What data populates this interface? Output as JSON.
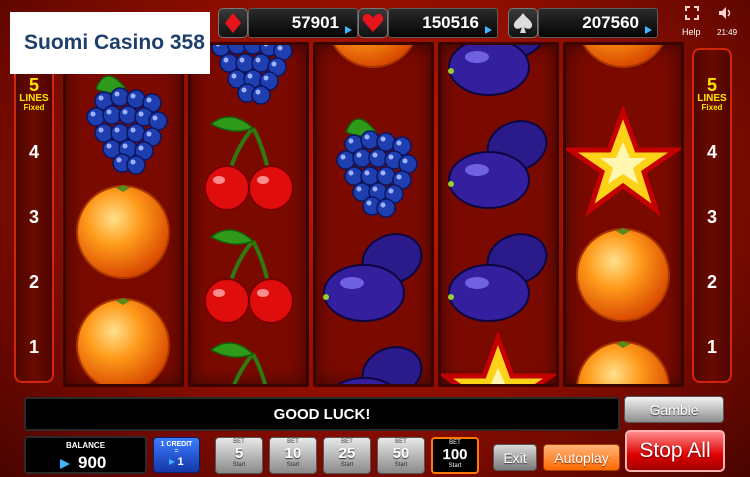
{
  "brand": {
    "title": "Suomi Casino 358"
  },
  "jackpots": [
    {
      "suit": "diamond-icon",
      "value": "57901"
    },
    {
      "suit": "heart-icon",
      "value": "150516"
    },
    {
      "suit": "spade-icon",
      "value": "207560"
    }
  ],
  "header": {
    "help_label": "Help",
    "time": "21:49"
  },
  "lines_panel": {
    "count": "5",
    "lines_label": "LINES",
    "fixed_label": "Fixed",
    "numbers": [
      "4",
      "3",
      "2",
      "1"
    ]
  },
  "reels": [
    [
      "grapes",
      "orange",
      "orange"
    ],
    [
      "grapes",
      "cherry",
      "cherry",
      "cherry"
    ],
    [
      "orange",
      "grapes",
      "plum",
      "plum"
    ],
    [
      "plum",
      "plum",
      "plum",
      "star"
    ],
    [
      "orange",
      "star",
      "orange",
      "orange"
    ]
  ],
  "message": "GOOD LUCK!",
  "buttons": {
    "gamble": "Gamble",
    "exit": "Exit",
    "autoplay": "Autoplay",
    "stop_all": "Stop All"
  },
  "balance": {
    "label": "BALANCE",
    "value": "900"
  },
  "credit": {
    "label": "1 CREDIT",
    "sep": "=",
    "value": "1"
  },
  "bets": [
    {
      "top": "BET",
      "value": "5",
      "bottom": "Start"
    },
    {
      "top": "BET",
      "value": "10",
      "bottom": "Start"
    },
    {
      "top": "BET",
      "value": "25",
      "bottom": "Start"
    },
    {
      "top": "BET",
      "value": "50",
      "bottom": "Start"
    },
    {
      "top": "BET",
      "value": "100",
      "bottom": "Start",
      "active": true
    }
  ],
  "colors": {
    "accent_blue": "#3fb6ff",
    "lines_yellow": "#ffe600",
    "stop_red": "#e00000",
    "autoplay_orange": "#ff6a00"
  }
}
